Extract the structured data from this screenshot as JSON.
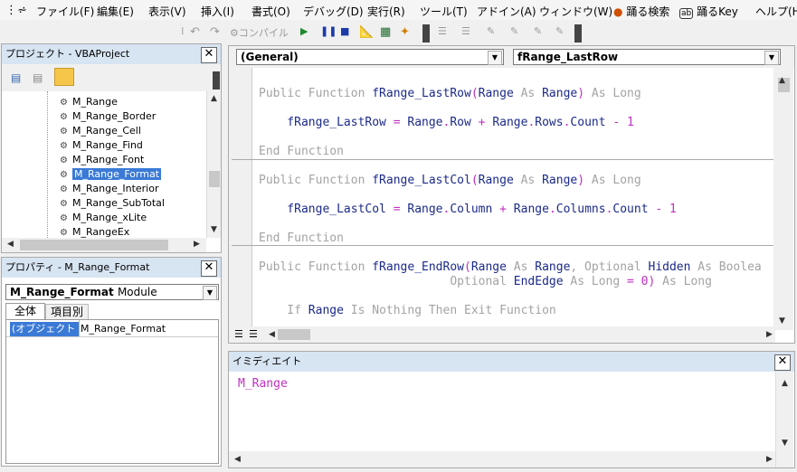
{
  "menu": [
    "ファイル(F)",
    "編集(E)",
    "表示(V)",
    "挿入(I)",
    "書式(O)",
    "デバッグ(D)",
    "実行(R)",
    "ツール(T)",
    "アドイン(A)",
    "ウィンドウ(W)",
    "踊る検索",
    "踊るKey",
    "ヘルプ(H)"
  ],
  "menu_icons": {
    "search_badge": "ab"
  },
  "toolbar": {
    "compile": "コンパイル"
  },
  "project": {
    "title": "プロジェクト - VBAProject",
    "items": [
      "M_Range",
      "M_Range_Border",
      "M_Range_Cell",
      "M_Range_Find",
      "M_Range_Font",
      "M_Range_Format",
      "M_Range_Interior",
      "M_Range_SubTotal",
      "M_Range_xLite",
      "M_RangeEx"
    ],
    "selected_index": 5
  },
  "properties": {
    "title": "プロパティ - M_Range_Format",
    "object_name": "M_Range_Format",
    "object_type": "Module",
    "tabs": [
      "全体",
      "項目別"
    ],
    "row_name": "(オブジェクト名)",
    "row_value": "M_Range_Format"
  },
  "code": {
    "object_combo": "(General)",
    "proc_combo": "fRange_LastRow",
    "lines": [
      {
        "segments": [
          {
            "t": "Public Function ",
            "c": "kw"
          },
          {
            "t": "fRange_LastRow",
            "c": "id"
          },
          {
            "t": "(",
            "c": "op"
          },
          {
            "t": "Range",
            "c": "id"
          },
          {
            "t": " As ",
            "c": "kw"
          },
          {
            "t": "Range",
            "c": "id"
          },
          {
            "t": ")",
            "c": "op"
          },
          {
            "t": " As Long",
            "c": "kw"
          }
        ]
      },
      {
        "segments": [
          {
            "t": "    fRange_LastRow",
            "c": "id"
          },
          {
            "t": " = ",
            "c": "op"
          },
          {
            "t": "Range",
            "c": "id"
          },
          {
            "t": ".",
            "c": "op"
          },
          {
            "t": "Row",
            "c": "id"
          },
          {
            "t": " + ",
            "c": "op"
          },
          {
            "t": "Range",
            "c": "id"
          },
          {
            "t": ".",
            "c": "op"
          },
          {
            "t": "Rows",
            "c": "id"
          },
          {
            "t": ".",
            "c": "op"
          },
          {
            "t": "Count",
            "c": "id"
          },
          {
            "t": " - 1",
            "c": "op"
          }
        ]
      },
      {
        "segments": [
          {
            "t": "End Function",
            "c": "kw"
          }
        ]
      },
      {
        "segments": [
          {
            "t": "Public Function ",
            "c": "kw"
          },
          {
            "t": "fRange_LastCol",
            "c": "id"
          },
          {
            "t": "(",
            "c": "op"
          },
          {
            "t": "Range",
            "c": "id"
          },
          {
            "t": " As ",
            "c": "kw"
          },
          {
            "t": "Range",
            "c": "id"
          },
          {
            "t": ")",
            "c": "op"
          },
          {
            "t": " As Long",
            "c": "kw"
          }
        ]
      },
      {
        "segments": [
          {
            "t": "    fRange_LastCol",
            "c": "id"
          },
          {
            "t": " = ",
            "c": "op"
          },
          {
            "t": "Range",
            "c": "id"
          },
          {
            "t": ".",
            "c": "op"
          },
          {
            "t": "Column",
            "c": "id"
          },
          {
            "t": " + ",
            "c": "op"
          },
          {
            "t": "Range",
            "c": "id"
          },
          {
            "t": ".",
            "c": "op"
          },
          {
            "t": "Columns",
            "c": "id"
          },
          {
            "t": ".",
            "c": "op"
          },
          {
            "t": "Count",
            "c": "id"
          },
          {
            "t": " - 1",
            "c": "op"
          }
        ]
      },
      {
        "segments": [
          {
            "t": "End Function",
            "c": "kw"
          }
        ]
      },
      {
        "segments": [
          {
            "t": "Public Function ",
            "c": "kw"
          },
          {
            "t": "fRange_EndRow",
            "c": "id"
          },
          {
            "t": "(",
            "c": "op"
          },
          {
            "t": "Range",
            "c": "id"
          },
          {
            "t": " As ",
            "c": "kw"
          },
          {
            "t": "Range",
            "c": "id"
          },
          {
            "t": ", Optional ",
            "c": "kw"
          },
          {
            "t": "Hidden",
            "c": "id"
          },
          {
            "t": " As Boolea",
            "c": "kw"
          }
        ]
      },
      {
        "segments": [
          {
            "t": "                           Optional ",
            "c": "kw"
          },
          {
            "t": "EndEdge",
            "c": "id"
          },
          {
            "t": " As Long",
            "c": "kw"
          },
          {
            "t": " = 0)",
            "c": "op"
          },
          {
            "t": " As Long",
            "c": "kw"
          }
        ]
      },
      {
        "segments": [
          {
            "t": "    If ",
            "c": "kw"
          },
          {
            "t": "Range",
            "c": "id"
          },
          {
            "t": " Is Nothing Then Exit Function",
            "c": "kw"
          }
        ]
      }
    ]
  },
  "immediate": {
    "title": "イミディエイト",
    "text": "M_Range"
  }
}
